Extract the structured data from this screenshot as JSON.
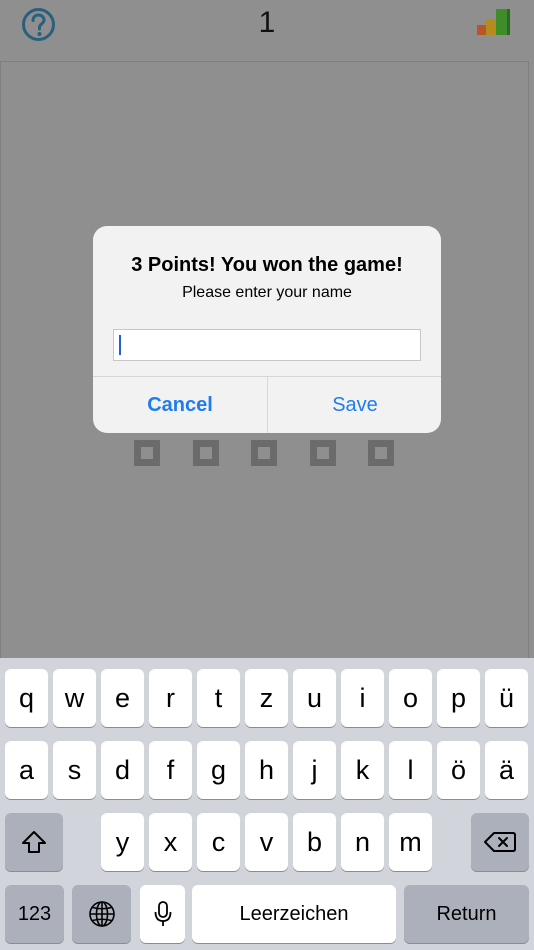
{
  "header": {
    "score": "1",
    "help_icon": "question-circle-icon",
    "stats_icon": "bar-chart-icon"
  },
  "alert": {
    "title": "3 Points! You won the game!",
    "message": "Please enter your name",
    "input_value": "",
    "input_placeholder": "",
    "cancel_label": "Cancel",
    "save_label": "Save"
  },
  "keyboard": {
    "row1": [
      "q",
      "w",
      "e",
      "r",
      "t",
      "z",
      "u",
      "i",
      "o",
      "p",
      "ü"
    ],
    "row2": [
      "a",
      "s",
      "d",
      "f",
      "g",
      "h",
      "j",
      "k",
      "l",
      "ö",
      "ä"
    ],
    "row3": [
      "y",
      "x",
      "c",
      "v",
      "b",
      "n",
      "m"
    ],
    "numbers_label": "123",
    "space_label": "Leerzeichen",
    "return_label": "Return",
    "shift_icon": "shift-icon",
    "backspace_icon": "backspace-icon",
    "globe_icon": "globe-icon",
    "mic_icon": "microphone-icon"
  },
  "colors": {
    "accent": "#1f7cf0",
    "overlay": "#8f8f8f",
    "keyboard_bg": "#d1d4da",
    "help_icon": "#2b6c8e"
  }
}
